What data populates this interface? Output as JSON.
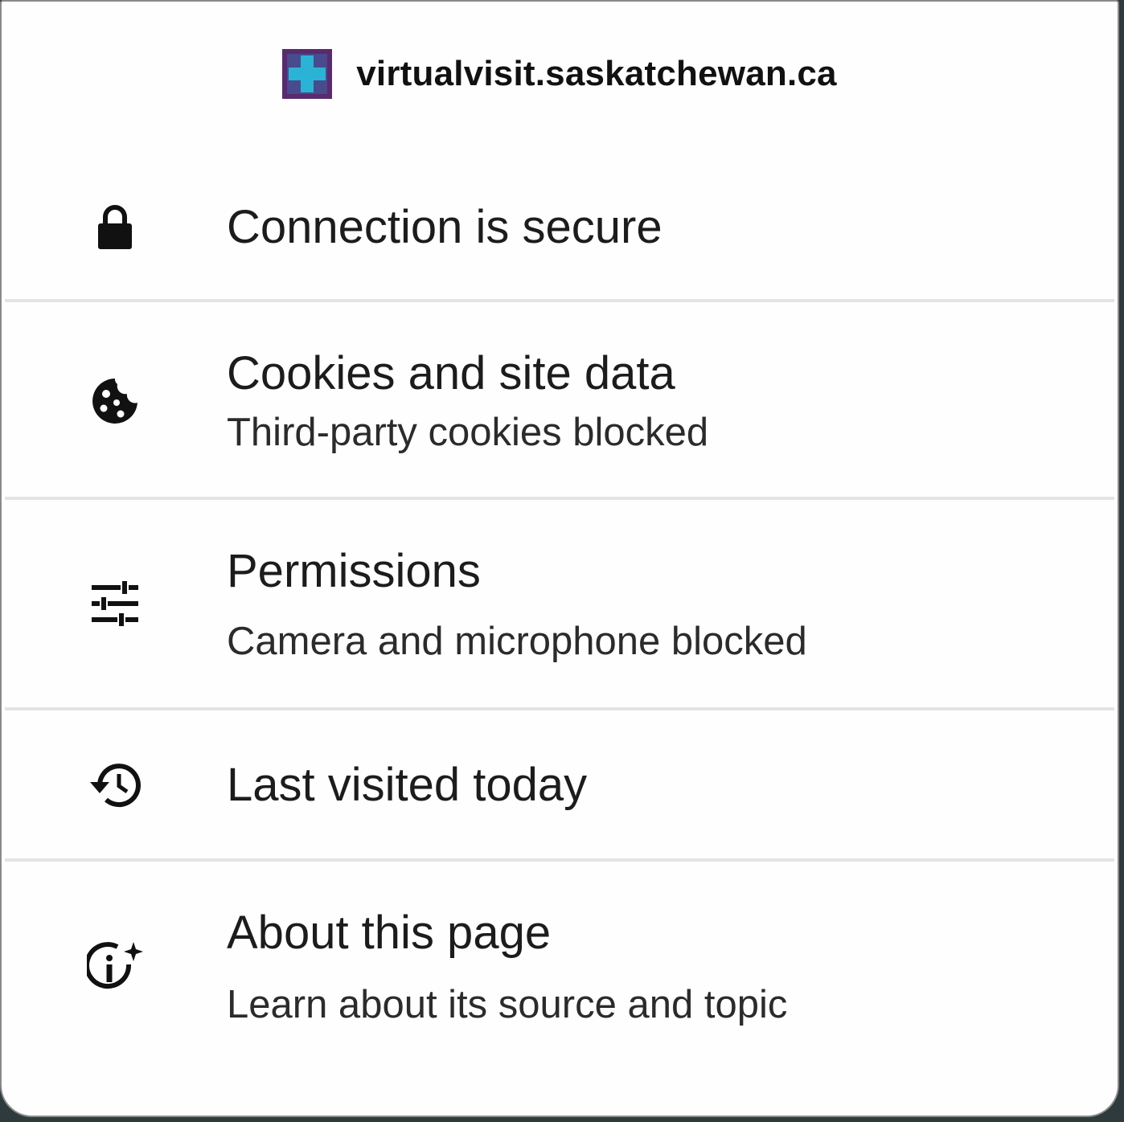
{
  "site": {
    "domain": "virtualvisit.saskatchewan.ca",
    "favicon_icon": "medical-cross-favicon",
    "favicon_colors": {
      "background": "#5a2a6e",
      "cross": "#2bb3d6"
    }
  },
  "items": [
    {
      "icon": "lock-icon",
      "title": "Connection is secure",
      "subtitle": ""
    },
    {
      "icon": "cookie-icon",
      "title": "Cookies and site data",
      "subtitle": "Third-party cookies blocked"
    },
    {
      "icon": "tune-sliders-icon",
      "title": "Permissions",
      "subtitle": "Camera and microphone blocked"
    },
    {
      "icon": "history-icon",
      "title": "Last visited today",
      "subtitle": ""
    },
    {
      "icon": "info-sparkle-icon",
      "title": "About this page",
      "subtitle": "Learn about its source and topic"
    }
  ]
}
